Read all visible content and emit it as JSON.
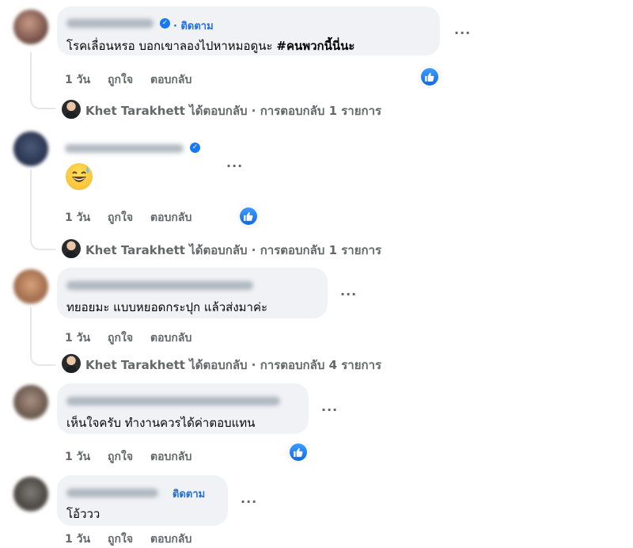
{
  "comments": [
    {
      "follow_label": "· ติดตาม",
      "text_plain": "โรคเลื่อนหรอ บอกเขาลองไปหาหมอดูนะ ",
      "text_hashtag": "#คนพวกนี้นี่นะ",
      "time": "1 วัน",
      "like_label": "ถูกใจ",
      "reply_label": "ตอบกลับ",
      "has_like_badge": true,
      "replies_summary": {
        "author": "Khet Tarakhett",
        "action": " ได้ตอบกลับ",
        "separator": " · ",
        "count_text": "การตอบกลับ 1 รายการ"
      }
    },
    {
      "emoji": "sweat-smile-emoji",
      "time": "1 วัน",
      "like_label": "ถูกใจ",
      "reply_label": "ตอบกลับ",
      "has_like_badge": true,
      "replies_summary": {
        "author": "Khet Tarakhett",
        "action": " ได้ตอบกลับ",
        "separator": " · ",
        "count_text": "การตอบกลับ 1 รายการ"
      }
    },
    {
      "text": "ทยอยมะ แบบหยอดกระปุก แล้วส่งมาค่ะ",
      "time": "1 วัน",
      "like_label": "ถูกใจ",
      "reply_label": "ตอบกลับ",
      "replies_summary": {
        "author": "Khet Tarakhett",
        "action": " ได้ตอบกลับ",
        "separator": " · ",
        "count_text": "การตอบกลับ 4 รายการ"
      }
    },
    {
      "text": "เห็นใจครับ ทำงานควรได้ค่าตอบแทน",
      "time": "1 วัน",
      "like_label": "ถูกใจ",
      "reply_label": "ตอบกลับ",
      "has_like_badge": true
    },
    {
      "follow_label": "ติดตาม",
      "text": "โอ้ววว",
      "time": "1 วัน",
      "like_label": "ถูกใจ",
      "reply_label": "ตอบกลับ"
    }
  ],
  "more_icon": "more-options-icon",
  "colors": {
    "bubble": "#f0f2f5",
    "link_blue": "#216fdb",
    "meta_gray": "#65676b",
    "like_blue": "#1877f2"
  }
}
